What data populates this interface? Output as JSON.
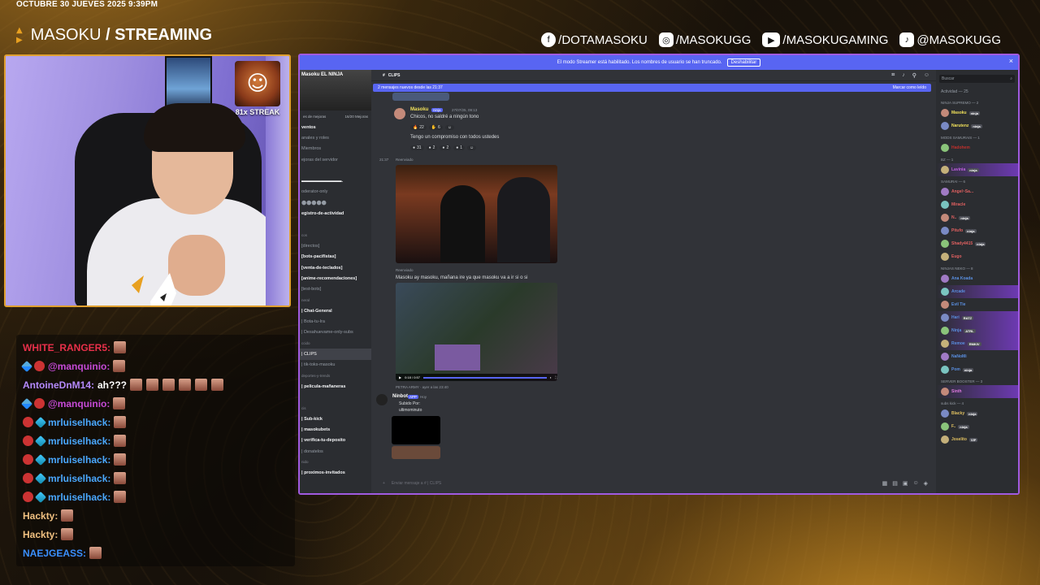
{
  "date_bar": "OCTUBRE 30 JUEVES 2025 9:39PM",
  "brand": {
    "name": "MASOKU",
    "suffix": "STREAMING"
  },
  "socials": [
    {
      "icon": "facebook-icon",
      "label": "/DOTAMASOKU"
    },
    {
      "icon": "instagram-icon",
      "label": "/MASOKUGG"
    },
    {
      "icon": "youtube-icon",
      "label": "/MASOKUGAMING"
    },
    {
      "icon": "tiktok-icon",
      "label": "@MASOKUGG"
    }
  ],
  "streak": "81x STREAK",
  "chat": [
    {
      "user": "WHITE_RANGER5:",
      "color": "#e8304a",
      "badge": "",
      "msg": "",
      "emotes": 1
    },
    {
      "user": "@manquinio:",
      "color": "#c64ad6",
      "badge": "sword",
      "msg": "",
      "emotes": 1
    },
    {
      "user": "AntoineDnM14:",
      "color": "#b58aff",
      "badge": "",
      "msg": "ah???",
      "emotes": 6
    },
    {
      "user": "@manquinio:",
      "color": "#c64ad6",
      "badge": "sword",
      "msg": "",
      "emotes": 1
    },
    {
      "user": "mrluiselhack:",
      "color": "#4aa8ff",
      "badge": "cube",
      "msg": "",
      "emotes": 1
    },
    {
      "user": "mrluiselhack:",
      "color": "#4aa8ff",
      "badge": "cube",
      "msg": "",
      "emotes": 1
    },
    {
      "user": "mrluiselhack:",
      "color": "#4aa8ff",
      "badge": "cube",
      "msg": "",
      "emotes": 1
    },
    {
      "user": "mrluiselhack:",
      "color": "#4aa8ff",
      "badge": "cube",
      "msg": "",
      "emotes": 1
    },
    {
      "user": "mrluiselhack:",
      "color": "#4aa8ff",
      "badge": "cube",
      "msg": "",
      "emotes": 1
    },
    {
      "user": "Hackty:",
      "color": "#f0c080",
      "badge": "",
      "msg": "",
      "emotes": 1
    },
    {
      "user": "Hackty:",
      "color": "#f0c080",
      "badge": "",
      "msg": "",
      "emotes": 1
    },
    {
      "user": "NAEJGEASS:",
      "color": "#3a8fff",
      "badge": "",
      "msg": "",
      "emotes": 1
    }
  ],
  "discord": {
    "banner": "El modo Streamer está habilitado. Los nombres de usuario se han truncado.",
    "banner_button": "Deshabilitar",
    "server_name": "Masoku EL NINJA",
    "boost_left": "es de mejoras",
    "boost_right": "16/20 Mejoras",
    "channels": [
      {
        "label": "ventos",
        "kind": "bright"
      },
      {
        "label": "anales y roles",
        "kind": "normal"
      },
      {
        "label": "Miembros",
        "kind": "normal"
      },
      {
        "label": "ejoras del servidor",
        "kind": "normal"
      },
      {
        "label": "",
        "kind": "normal"
      },
      {
        "label": "▬▬▬▬▬▬▬▬▬.",
        "kind": "bright"
      },
      {
        "label": "oderator-only",
        "kind": "normal"
      },
      {
        "label": "⬤⬤⬤⬤⬤",
        "kind": "normal"
      },
      {
        "label": "egistro-de-actividad",
        "kind": "bright"
      },
      {
        "label": "",
        "kind": "normal"
      },
      {
        "label": "cos",
        "kind": "cat"
      },
      {
        "label": "[directos]",
        "kind": "normal"
      },
      {
        "label": "[bots-pacifistas]",
        "kind": "bright"
      },
      {
        "label": "[venta-de-teclados]",
        "kind": "bright"
      },
      {
        "label": "[anime-recomendaciones]",
        "kind": "bright"
      },
      {
        "label": "[test-bots]",
        "kind": "normal"
      },
      {
        "label": "neral",
        "kind": "cat"
      },
      {
        "label": "| Chat-General",
        "kind": "bright"
      },
      {
        "label": "| Bota-tu-Ira",
        "kind": "normal"
      },
      {
        "label": "| Desahuevame-only-subs",
        "kind": "normal"
      },
      {
        "label": "ccido",
        "kind": "cat"
      },
      {
        "label": "| CLIPS",
        "kind": "sel"
      },
      {
        "label": "| tik-toks-masoku",
        "kind": "normal"
      },
      {
        "label": "DEPORTES-Y-TRENDS",
        "kind": "cat"
      },
      {
        "label": "| pelicula-mañaneras",
        "kind": "bright"
      },
      {
        "label": "",
        "kind": "normal"
      },
      {
        "label": "cis",
        "kind": "cat"
      },
      {
        "label": "| Sub-kick",
        "kind": "bright"
      },
      {
        "label": "| masokubets",
        "kind": "bright"
      },
      {
        "label": "| verifica-tu-deposito",
        "kind": "bright"
      },
      {
        "label": "| donatelos",
        "kind": "normal"
      },
      {
        "label": "nido",
        "kind": "cat"
      },
      {
        "label": "| proximos-invitados",
        "kind": "bright"
      }
    ],
    "channel_title": "CLIPS",
    "new_messages": "2 mensajes nuevos desde las 21:37",
    "mark_read": "Marcar como leído",
    "messages": {
      "author1": "Masoku",
      "author1_tag": "ninja",
      "author1_time": "27/07/25, 09:13",
      "text1": "Chicos, no saldré a ningún tono",
      "reactions1": [
        "22",
        "6",
        ""
      ],
      "text2": "Tengo un compromiso con todos ustedes",
      "reactions2": [
        "31",
        "2",
        "2",
        "1",
        ""
      ],
      "forwarded1": "Reenviado",
      "time_left": "21:37",
      "forwarded2": "Reenviado",
      "text3": "Masoku ay masoku, mañana ire ya que masoku va a ir si o si",
      "video_time": "0:18 / 0:57",
      "clip_footer": "PETRA ARMY · ayer a las 23:40",
      "bot_name": "Ninbot",
      "bot_tag": "APP",
      "bot_time": "Hoy",
      "bot_line1": "Subido Por:",
      "bot_line2": "ultimominuto"
    },
    "input_placeholder": "Enviar mensaje a # | CLIPS",
    "search_placeholder": "Buscar",
    "activity": "Actividad — 25",
    "member_groups": [
      {
        "role": "NINJA SUPREMO — 2",
        "members": [
          {
            "name": "Masoku",
            "color": "#f0e05a",
            "tag": "ninja",
            "hl": false
          },
          {
            "name": "Narutenz",
            "color": "#f0e05a",
            "tag": "ninja",
            "hl": false
          }
        ]
      },
      {
        "role": "MODS SAMURAIS — 1",
        "members": [
          {
            "name": "Hadohem",
            "color": "#c0302c",
            "tag": "",
            "hl": false
          }
        ]
      },
      {
        "role": "BZ — 1",
        "members": [
          {
            "name": "Lavinia",
            "color": "#c060e0",
            "tag": "ninja",
            "hl": true
          }
        ]
      },
      {
        "role": "SAMURAI — 6",
        "members": [
          {
            "name": "Angel~Sa...",
            "color": "#e06060",
            "tag": "",
            "hl": false
          },
          {
            "name": "Miracle",
            "color": "#e06060",
            "tag": "",
            "hl": false
          },
          {
            "name": "N..",
            "color": "#e06060",
            "tag": "ninja",
            "hl": false
          },
          {
            "name": "Pitufo",
            "color": "#e06060",
            "tag": "ninja",
            "hl": false
          },
          {
            "name": "Shady4415",
            "color": "#e06060",
            "tag": "ninja",
            "hl": false
          },
          {
            "name": "Eugo",
            "color": "#e06060",
            "tag": "",
            "hl": false
          }
        ]
      },
      {
        "role": "NINJAS NEKO — 8",
        "members": [
          {
            "name": "Ana Koada",
            "color": "#5a8fe0",
            "tag": "",
            "hl": false
          },
          {
            "name": "Arcade",
            "color": "#5a8fe0",
            "tag": "",
            "hl": true
          },
          {
            "name": "Evil Tie",
            "color": "#5a8fe0",
            "tag": "",
            "hl": false
          },
          {
            "name": "Hari",
            "color": "#5a8fe0",
            "tag": "RATZ",
            "hl": true
          },
          {
            "name": "Ninja",
            "color": "#5a8fe0",
            "tag": "ATRL",
            "hl": true
          },
          {
            "name": "Remoe",
            "color": "#5a8fe0",
            "tag": "RMKIV",
            "hl": true
          },
          {
            "name": "NaNoMi",
            "color": "#5a8fe0",
            "tag": "",
            "hl": false
          },
          {
            "name": "Pom",
            "color": "#5a8fe0",
            "tag": "ninja",
            "hl": false
          }
        ]
      },
      {
        "role": "SERVER BOOSTER — 3",
        "members": [
          {
            "name": "Sinth",
            "color": "#e07ae0",
            "tag": "",
            "hl": true
          }
        ]
      },
      {
        "role": "subs kick — 4",
        "members": [
          {
            "name": "Blacky",
            "color": "#e0c060",
            "tag": "ninja",
            "hl": false
          },
          {
            "name": "F..",
            "color": "#e0c060",
            "tag": "ninja",
            "hl": false
          },
          {
            "name": "Joselito",
            "color": "#e0c060",
            "tag": "VIP",
            "hl": false
          }
        ]
      }
    ]
  }
}
